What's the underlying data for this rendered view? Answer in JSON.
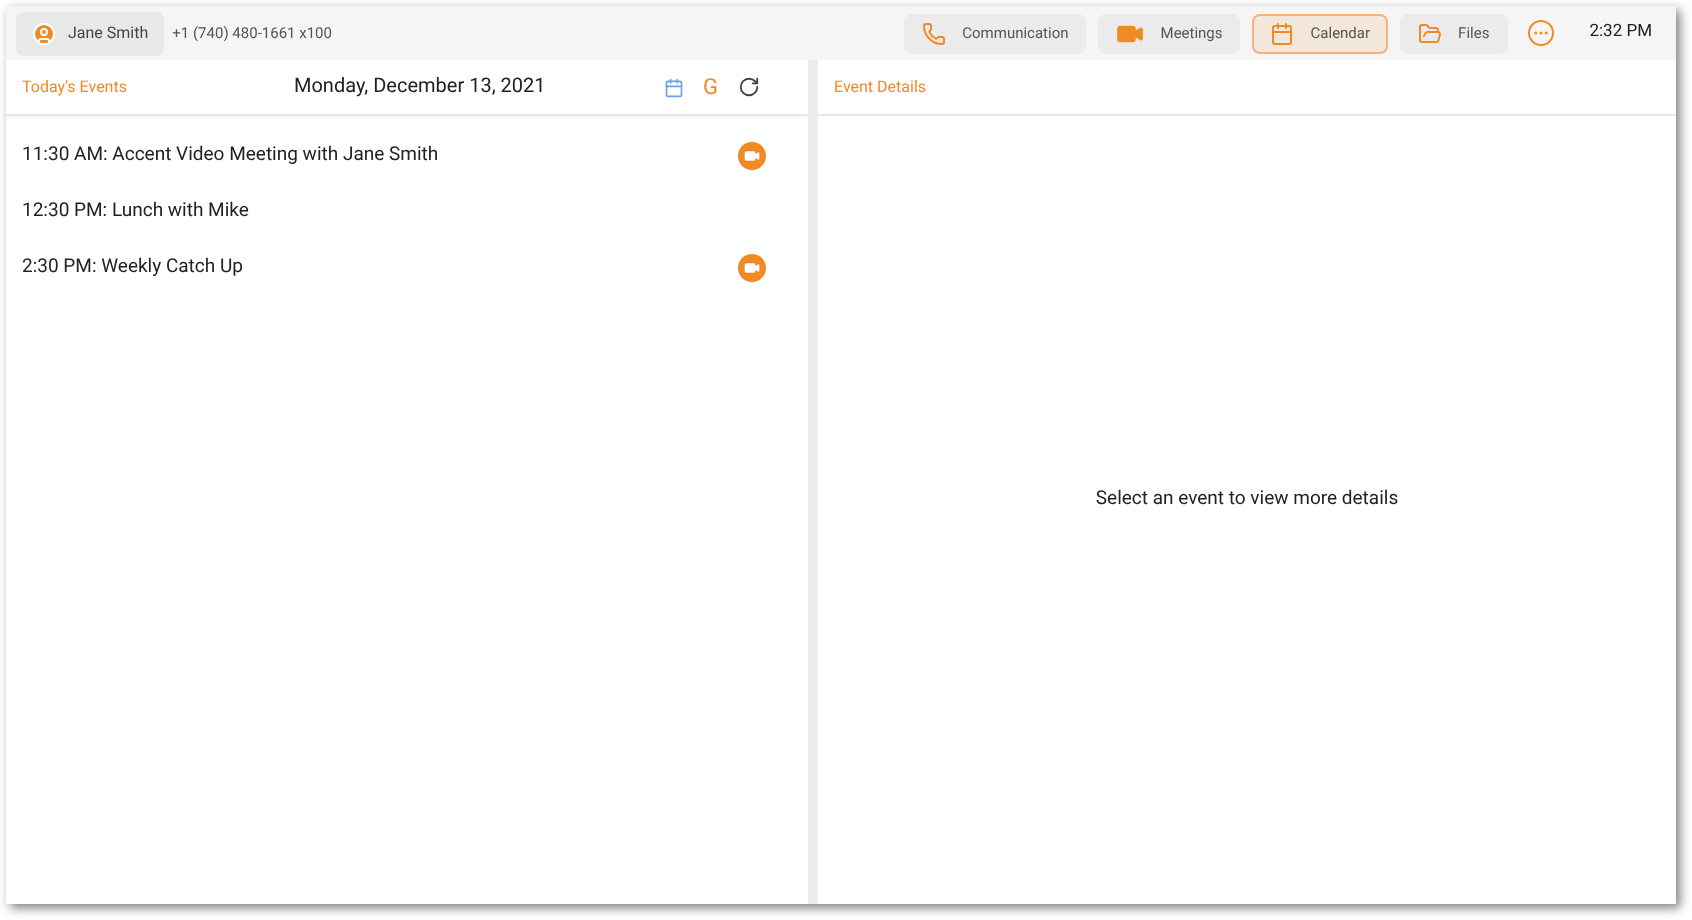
{
  "contact": {
    "name": "Jane Smith",
    "phone": "+1 (740) 480-1661 x100"
  },
  "nav": [
    {
      "label": "Communication",
      "kind": "phone",
      "selected": false
    },
    {
      "label": "Meetings",
      "kind": "video",
      "selected": false
    },
    {
      "label": "Calendar",
      "kind": "calendar",
      "selected": true
    },
    {
      "label": "Files",
      "kind": "folder",
      "selected": false
    }
  ],
  "clock": "2:32 PM",
  "events_panel": {
    "title": "Today's Events",
    "date": "Monday, December 13, 2021",
    "google_label": "G"
  },
  "events": [
    {
      "text": "11:30 AM: Accent Video Meeting with Jane Smith",
      "video": true
    },
    {
      "text": "12:30 PM: Lunch with Mike",
      "video": false
    },
    {
      "text": "2:30 PM: Weekly Catch Up",
      "video": true
    }
  ],
  "details_panel": {
    "title": "Event Details",
    "empty_message": "Select an event to view more details"
  }
}
